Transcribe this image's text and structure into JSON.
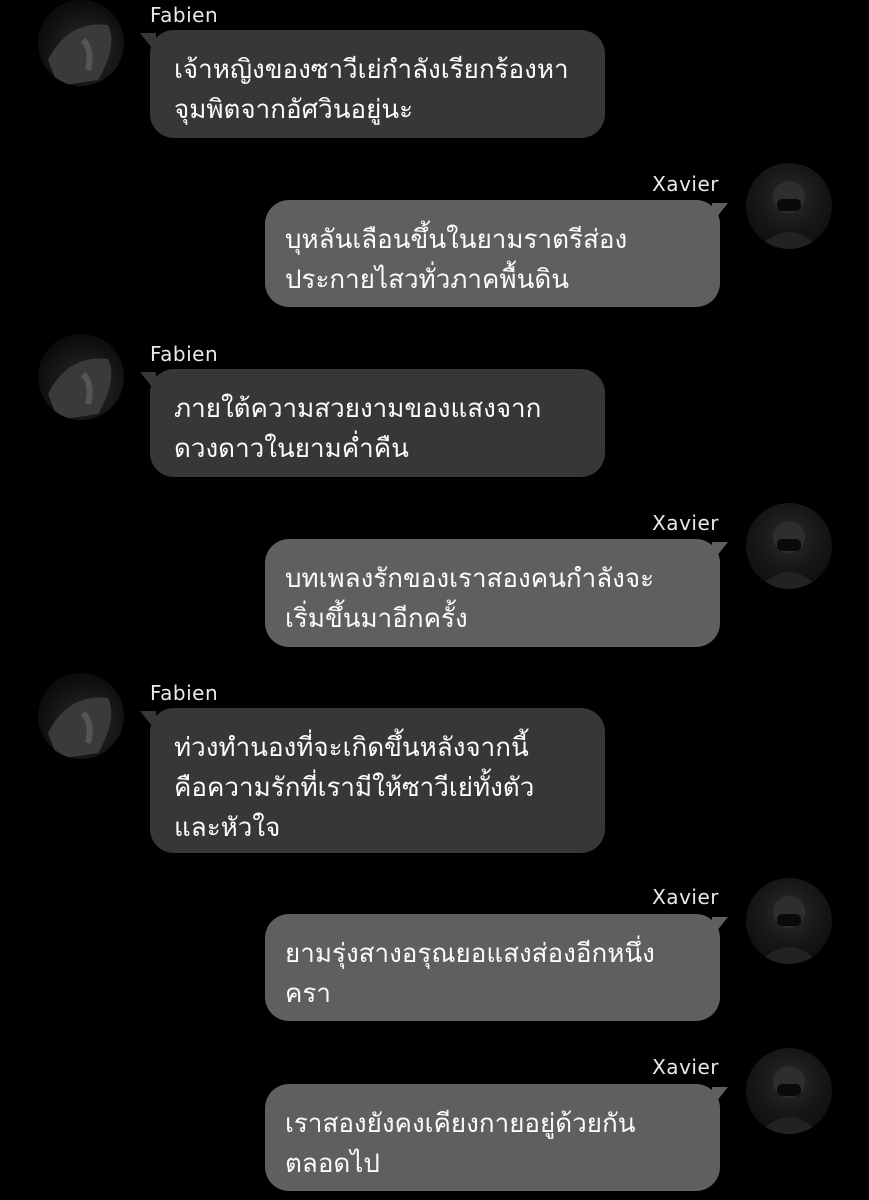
{
  "messages": [
    {
      "side": "left",
      "sender": "Fabien",
      "lines": [
        "เจ้าหญิงของซาวีเย่กำลังเรียกร้องหา",
        "จุมพิตจากอัศวินอยู่นะ"
      ]
    },
    {
      "side": "right",
      "sender": "Xavier",
      "lines": [
        "บุหลันเลือนขึ้นในยามราตรีส่อง",
        "ประกายไสวทั่วภาคพื้นดิน"
      ]
    },
    {
      "side": "left",
      "sender": "Fabien",
      "lines": [
        "ภายใต้ความสวยงามของแสงจาก",
        "ดวงดาวในยามค่ำคืน"
      ]
    },
    {
      "side": "right",
      "sender": "Xavier",
      "lines": [
        "บทเพลงรักของเราสองคนกำลังจะ",
        "เริ่มขึ้นมาอีกครั้ง"
      ]
    },
    {
      "side": "left",
      "sender": "Fabien",
      "lines": [
        "ท่วงทำนองที่จะเกิดขึ้นหลังจากนี้",
        "คือความรักที่เรามีให้ซาวีเย่ทั้งตัว",
        "และหัวใจ"
      ]
    },
    {
      "side": "right",
      "sender": "Xavier",
      "lines": [
        "ยามรุ่งสางอรุณยอแสงส่องอีกหนึ่ง",
        "ครา"
      ]
    },
    {
      "side": "right",
      "sender": "Xavier",
      "lines": [
        "เราสองยังคงเคียงกายอยู่ด้วยกัน",
        "ตลอดไป"
      ]
    }
  ]
}
